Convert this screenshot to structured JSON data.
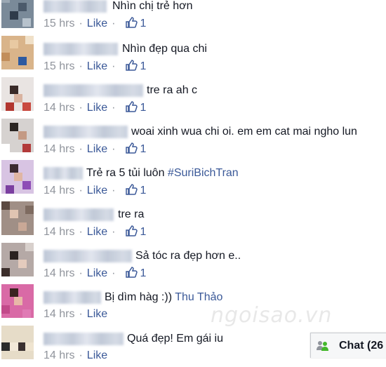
{
  "comments": [
    {
      "text": "Nhìn chị trẻ hơn",
      "tag": "",
      "time": "15 hrs",
      "like_label": "Like",
      "likes": "1"
    },
    {
      "text": "Nhìn đẹp qua chi",
      "tag": "",
      "time": "15 hrs",
      "like_label": "Like",
      "likes": "1"
    },
    {
      "text": "tre ra ah c",
      "tag": "",
      "time": "14 hrs",
      "like_label": "Like",
      "likes": "1"
    },
    {
      "text": "woai xinh wua chi oi. em em cat mai ngho lun",
      "tag": "",
      "time": "14 hrs",
      "like_label": "Like",
      "likes": "1"
    },
    {
      "text": "Trẻ ra 5 tủi luôn",
      "tag": "#SuriBichTran",
      "time": "14 hrs",
      "like_label": "Like",
      "likes": "1"
    },
    {
      "text": "tre ra",
      "tag": "",
      "time": "14 hrs",
      "like_label": "Like",
      "likes": "1"
    },
    {
      "text": "Sả tóc ra đẹp hơn e..",
      "tag": "",
      "time": "14 hrs",
      "like_label": "Like",
      "likes": "1"
    },
    {
      "text": "Bị dìm hàg :))",
      "tag": "Thu Thảo",
      "time": "14 hrs",
      "like_label": "Like",
      "likes": ""
    },
    {
      "text": "Quá đẹp! Em gái iu",
      "tag": "",
      "time": "14 hrs",
      "like_label": "Like",
      "likes": ""
    }
  ],
  "watermark": "ngoisao.vn",
  "chat": {
    "label": "Chat (26",
    "icon": "chat-people-icon"
  },
  "colors": {
    "link": "#3b5998",
    "meta": "#90949c",
    "text": "#141823"
  }
}
